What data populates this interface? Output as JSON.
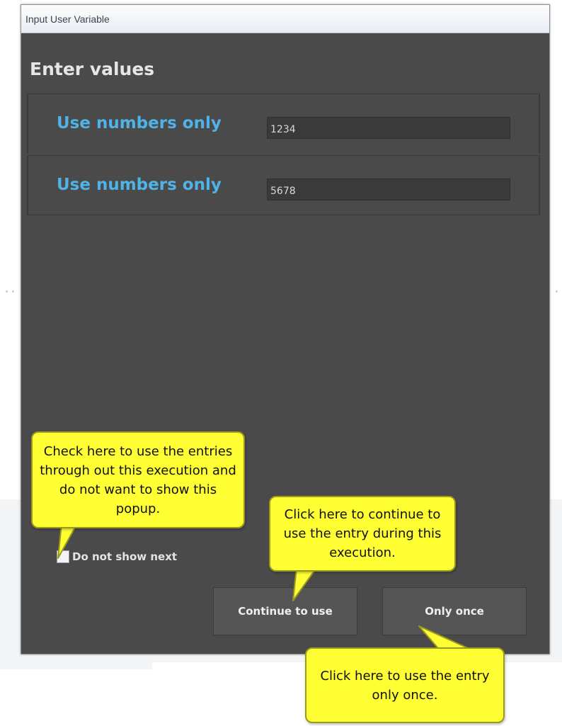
{
  "window": {
    "title": "Input User Variable"
  },
  "main": {
    "heading": "Enter values",
    "fields": [
      {
        "label": "Use numbers only",
        "value": "1234"
      },
      {
        "label": "Use numbers only",
        "value": "5678"
      }
    ]
  },
  "footer": {
    "checkbox_label": "Do not show next",
    "checkbox_checked": false,
    "continue_button": "Continue to use",
    "once_button": "Only once"
  },
  "callouts": {
    "checkbox_tip": "Check here to use the entries through out this execution and do not want to show this popup.",
    "continue_tip": "Click here to continue to use the entry during this execution.",
    "once_tip": "Click here to use the entry only once."
  },
  "colors": {
    "window_bg": "#4a4a4a",
    "label_accent": "#4fb3e8",
    "callout_bg": "#ffff33"
  }
}
